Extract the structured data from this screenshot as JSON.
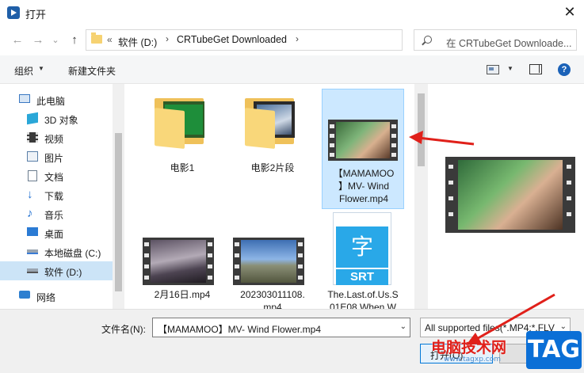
{
  "window": {
    "title": "打开",
    "close_glyph": "✕"
  },
  "nav": {
    "back": "←",
    "forward": "→",
    "recent": "⌄",
    "up": "↑",
    "refresh": "↻"
  },
  "address": {
    "overflow": "«",
    "crumbs": [
      "软件 (D:)",
      "CRTubeGet Downloaded"
    ],
    "sep": "›"
  },
  "search": {
    "placeholder": "在 CRTubeGet Downloade..."
  },
  "toolbar": {
    "organize": "组织",
    "caret": "▼",
    "new_folder": "新建文件夹"
  },
  "sidebar": {
    "items": [
      {
        "label": "此电脑",
        "icon": "computer-icon"
      },
      {
        "label": "3D 对象",
        "icon": "cube-icon"
      },
      {
        "label": "视频",
        "icon": "video-icon"
      },
      {
        "label": "图片",
        "icon": "picture-icon"
      },
      {
        "label": "文档",
        "icon": "document-icon"
      },
      {
        "label": "下载",
        "icon": "download-icon"
      },
      {
        "label": "音乐",
        "icon": "music-icon"
      },
      {
        "label": "桌面",
        "icon": "desktop-icon"
      },
      {
        "label": "本地磁盘 (C:)",
        "icon": "drive-icon"
      },
      {
        "label": "软件 (D:)",
        "icon": "drive-icon",
        "selected": true
      },
      {
        "label": "网络",
        "icon": "network-icon"
      }
    ]
  },
  "files": [
    {
      "label": "电影1",
      "kind": "folder"
    },
    {
      "label": "电影2片段",
      "kind": "folder"
    },
    {
      "label": "【MAMAMOO】MV- Wind Flower.mp4",
      "kind": "video",
      "selected": true
    },
    {
      "label": "2月16日.mp4",
      "kind": "video"
    },
    {
      "label": "20230301110...mp4",
      "kind": "video"
    },
    {
      "label": "The.Last.of.Us.S01E08.When.W",
      "kind": "srt"
    }
  ],
  "file_lines": {
    "f0": [
      "电影1"
    ],
    "f1": [
      "电影2片段"
    ],
    "f2": [
      "【MAMAMOO",
      "】MV- Wind",
      "Flower.mp4"
    ],
    "f3": [
      "2月16日.mp4"
    ],
    "f4": [
      "202303011108.",
      "mp4"
    ],
    "f5": [
      "The.Last.of.Us.S",
      "01E08.When.W"
    ]
  },
  "srt_icon": {
    "glyph": "字",
    "text": "SRT"
  },
  "bottom": {
    "filename_label": "文件名(N):",
    "filename_value": "【MAMAMOO】MV- Wind Flower.mp4",
    "dropdown_caret": "⌄",
    "filetype_value": "All supported files(*.MP4;*.FLV",
    "open_label": "打开(O)"
  },
  "watermark": {
    "text": "电脑技术网",
    "url": "www.tagxp.com",
    "tag": "TAG"
  },
  "colors": {
    "selection": "#cce8ff",
    "accent": "#0078d7",
    "arrow": "#e0201a",
    "folder": "#f9d77a"
  }
}
